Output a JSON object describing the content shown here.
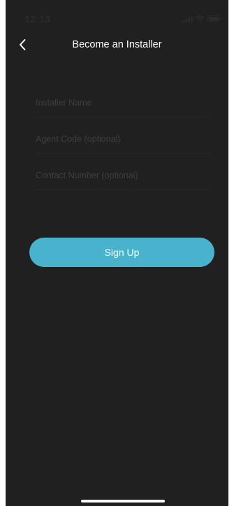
{
  "status_bar": {
    "time": "12:13",
    "signal_icon": "signal-bars-icon",
    "wifi_icon": "wifi-icon",
    "battery_icon": "battery-icon"
  },
  "nav": {
    "back_icon": "chevron-left-icon",
    "title": "Become an Installer"
  },
  "form": {
    "installer_name": {
      "value": "",
      "placeholder": "Installer Name"
    },
    "agent_code": {
      "value": "",
      "placeholder": "Agent Code (optional)"
    },
    "contact_number": {
      "value": "",
      "placeholder": "Contact Number (optional)"
    }
  },
  "signup": {
    "label": "Sign Up"
  },
  "colors": {
    "background": "#202020",
    "accent": "#49b3ce",
    "title_text": "#ffffff",
    "placeholder_text": "#3e3e3e"
  }
}
